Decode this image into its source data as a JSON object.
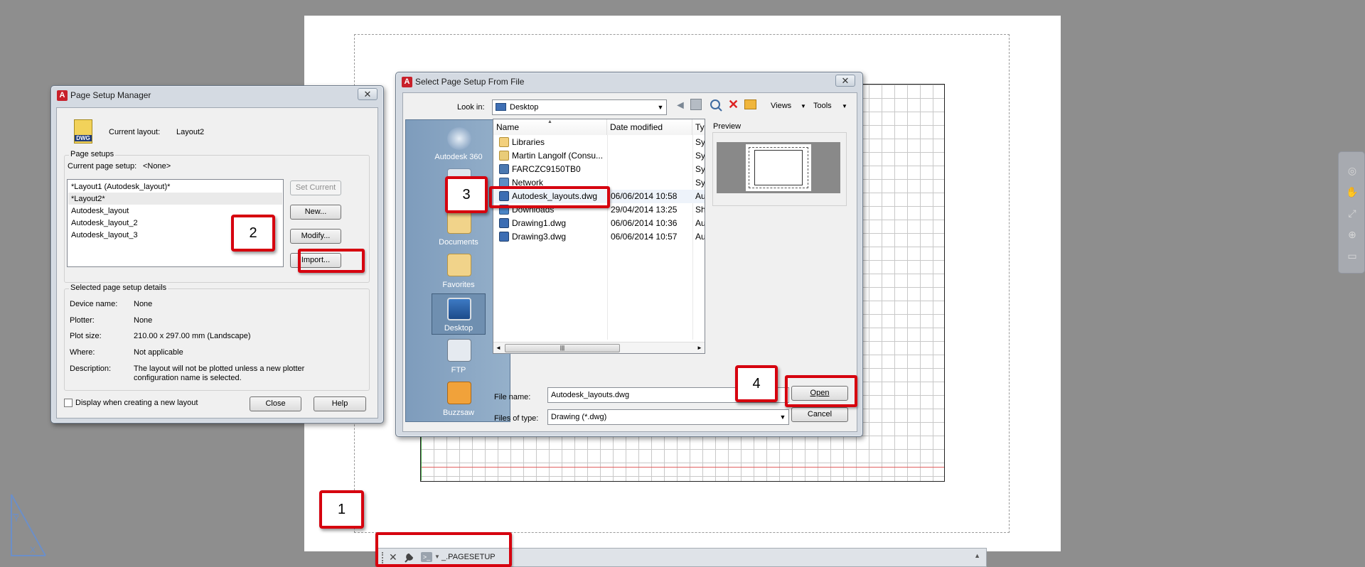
{
  "canvas": {
    "command_line": {
      "text": "_.PAGESETUP",
      "close_icon": "close-icon",
      "customize_icon": "wrench-icon",
      "prompt_icon": "command-prompt-icon",
      "expand_icon": "caret-up-icon"
    },
    "ucs_icon": "ucs-icon",
    "navigation_bar": [
      "steering-wheel-icon",
      "pan-icon",
      "zoom-icon",
      "orbit-icon",
      "showmotion-icon"
    ]
  },
  "page_setup_manager": {
    "title": "Page Setup Manager",
    "current_layout_label": "Current layout:",
    "current_layout_value": "Layout2",
    "dwg_icon_text": "DWG",
    "page_setups_group": "Page setups",
    "current_page_setup_label": "Current page setup:",
    "current_page_setup_value": "<None>",
    "setups": [
      "*Layout1 (Autodesk_layout)*",
      "*Layout2*",
      "Autodesk_layout",
      "Autodesk_layout_2",
      "Autodesk_layout_3"
    ],
    "selected_setup": "*Layout2*",
    "buttons": {
      "set_current": "Set Current",
      "new": "New...",
      "modify": "Modify...",
      "import": "Import..."
    },
    "details_group": "Selected page setup details",
    "details": [
      {
        "label": "Device name:",
        "value": "None"
      },
      {
        "label": "Plotter:",
        "value": "None"
      },
      {
        "label": "Plot size:",
        "value": "210.00 x 297.00 mm (Landscape)"
      },
      {
        "label": "Where:",
        "value": "Not applicable"
      },
      {
        "label": "Description:",
        "value": "The layout will not be plotted unless a new plotter configuration name is selected."
      }
    ],
    "display_checkbox_label": "Display when creating a new layout",
    "display_checkbox_checked": false,
    "close_button": "Close",
    "help_button": "Help"
  },
  "select_file_dialog": {
    "title": "Select Page Setup From File",
    "look_in_label": "Look in:",
    "look_in_value": "Desktop",
    "toolbar": {
      "back_icon": "back-arrow-icon",
      "up_icon": "up-folder-icon",
      "search_icon": "search-web-icon",
      "delete_icon": "delete-icon",
      "new_folder_icon": "new-folder-icon",
      "views_label": "Views",
      "tools_label": "Tools"
    },
    "places": [
      {
        "label": "Autodesk 360",
        "icon": "autodesk-360-icon"
      },
      {
        "label": "History",
        "icon": "history-icon"
      },
      {
        "label": "Documents",
        "icon": "documents-folder-icon"
      },
      {
        "label": "Favorites",
        "icon": "favorites-folder-icon"
      },
      {
        "label": "Desktop",
        "icon": "desktop-icon"
      },
      {
        "label": "FTP",
        "icon": "ftp-icon"
      },
      {
        "label": "Buzzsaw",
        "icon": "buzzsaw-icon"
      }
    ],
    "columns": [
      "Name",
      "Date modified",
      "Ty"
    ],
    "files": [
      {
        "name": "Libraries",
        "date": "",
        "type": "Sy",
        "icon": "libraries-icon"
      },
      {
        "name": "Martin Langolf (Consu...",
        "date": "",
        "type": "Sy",
        "icon": "user-folder-icon"
      },
      {
        "name": "FARCZC9150TB0",
        "date": "",
        "type": "Sy",
        "icon": "computer-icon"
      },
      {
        "name": "Network",
        "date": "",
        "type": "Sy",
        "icon": "network-icon"
      },
      {
        "name": "Autodesk_layouts.dwg",
        "date": "06/06/2014 10:58",
        "type": "Au",
        "icon": "dwg-file-icon"
      },
      {
        "name": "Downloads",
        "date": "29/04/2014 13:25",
        "type": "Sh",
        "icon": "downloads-folder-icon"
      },
      {
        "name": "Drawing1.dwg",
        "date": "06/06/2014 10:36",
        "type": "Au",
        "icon": "dwg-file-icon"
      },
      {
        "name": "Drawing3.dwg",
        "date": "06/06/2014 10:57",
        "type": "Au",
        "icon": "dwg-file-icon"
      }
    ],
    "scroll_grip": "|||",
    "preview_label": "Preview",
    "file_name_label": "File name:",
    "file_name_value": "Autodesk_layouts.dwg",
    "files_of_type_label": "Files of type:",
    "files_of_type_value": "Drawing (*.dwg)",
    "open_button": "Open",
    "cancel_button": "Cancel"
  },
  "callouts": [
    "1",
    "2",
    "3",
    "4"
  ],
  "colors": {
    "callout_red": "#d6000e",
    "background_gray": "#8e8e8e",
    "places_blue": "#8aa6c3"
  }
}
